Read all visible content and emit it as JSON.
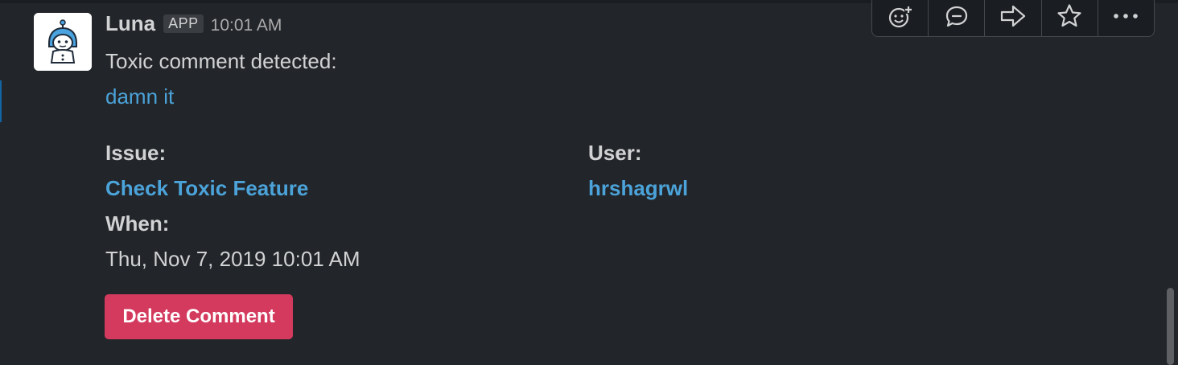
{
  "message": {
    "sender": "Luna",
    "badge": "APP",
    "time": "10:01 AM",
    "text": "Toxic comment detected:",
    "toxic_comment": "damn it"
  },
  "fields": {
    "issue_label": "Issue:",
    "issue_value": "Check Toxic Feature",
    "user_label": "User:",
    "user_value": "hrshagrwl",
    "when_label": "When:",
    "when_value": "Thu, Nov 7, 2019 10:01 AM"
  },
  "buttons": {
    "delete_label": "Delete Comment"
  },
  "actions": {
    "icons": [
      "add-reaction-icon",
      "reply-in-thread-icon",
      "share-message-icon",
      "star-icon",
      "more-actions-icon"
    ]
  },
  "colors": {
    "background": "#222529",
    "link": "#4ba3d9",
    "danger_button": "#d33a5e"
  }
}
